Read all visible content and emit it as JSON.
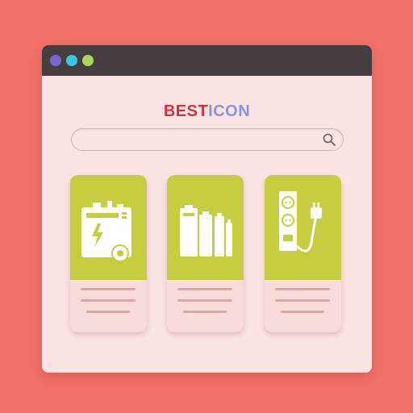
{
  "window": {
    "controls": [
      "window-control-purple",
      "window-control-cyan",
      "window-control-green"
    ]
  },
  "brand": {
    "part1": "BEST",
    "part2": "ICON"
  },
  "search": {
    "value": "",
    "placeholder": ""
  },
  "cards": [
    {
      "icon": "power-generator-icon"
    },
    {
      "icon": "batteries-icon"
    },
    {
      "icon": "power-strip-icon"
    }
  ],
  "colors": {
    "background": "#f3716a",
    "window_bg": "#f8e4e2",
    "titlebar": "#463e3e",
    "card_top": "#c6cd3f",
    "line": "#ef9ea0",
    "brand_red": "#d0333d",
    "brand_blue": "#8a94de"
  }
}
